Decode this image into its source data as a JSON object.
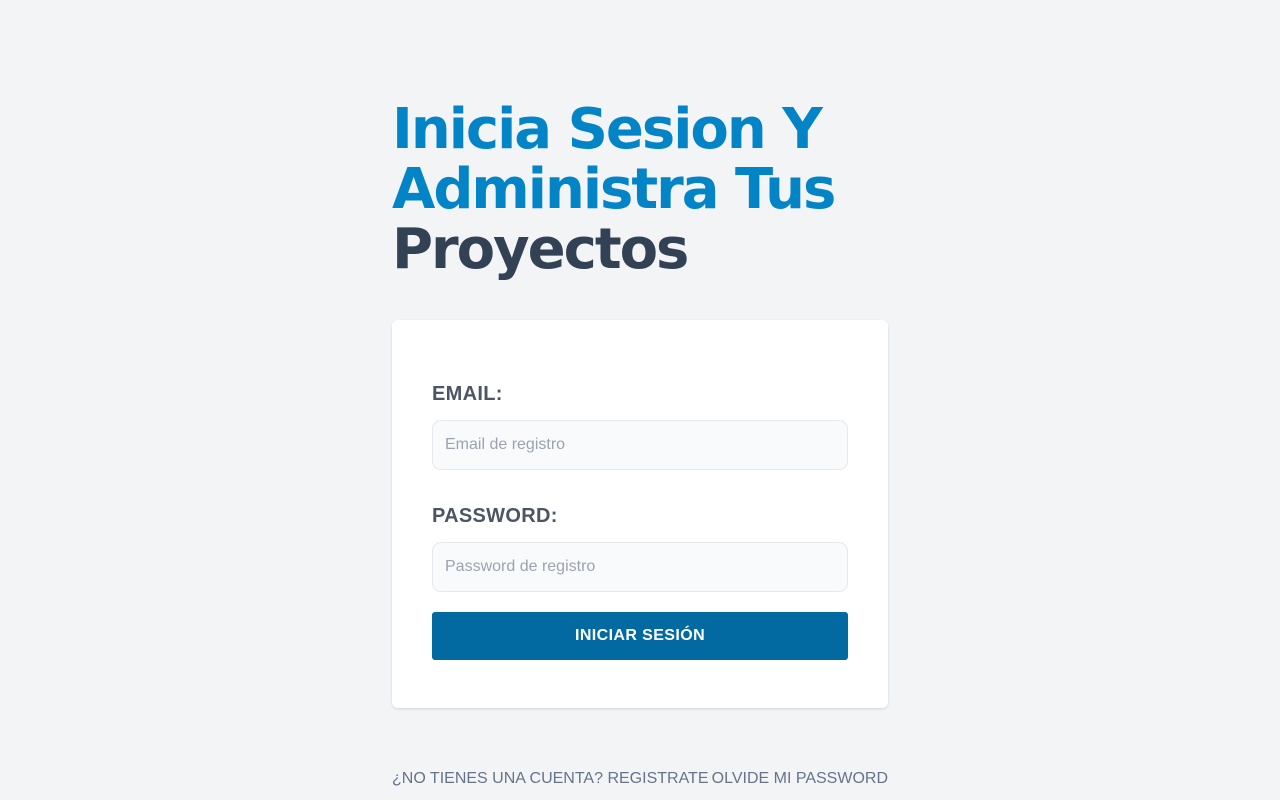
{
  "hero": {
    "line1": "Inicia Sesion Y",
    "line2": "Administra Tus",
    "line3": "Proyectos"
  },
  "form": {
    "email_label": "EMAIL:",
    "email_placeholder": "Email de registro",
    "email_value": "",
    "password_label": "PASSWORD:",
    "password_placeholder": "Password de registro",
    "password_value": "",
    "submit_label": "INICIAR SESIÓN"
  },
  "footer": {
    "register_link": "¿NO TIENES UNA CUENTA? REGISTRATE",
    "forgot_link": "OLVIDE MI PASSWORD"
  },
  "colors": {
    "accent": "#0284c7",
    "heading_dark": "#334155",
    "button": "#0369a1",
    "background": "#f3f4f6"
  }
}
